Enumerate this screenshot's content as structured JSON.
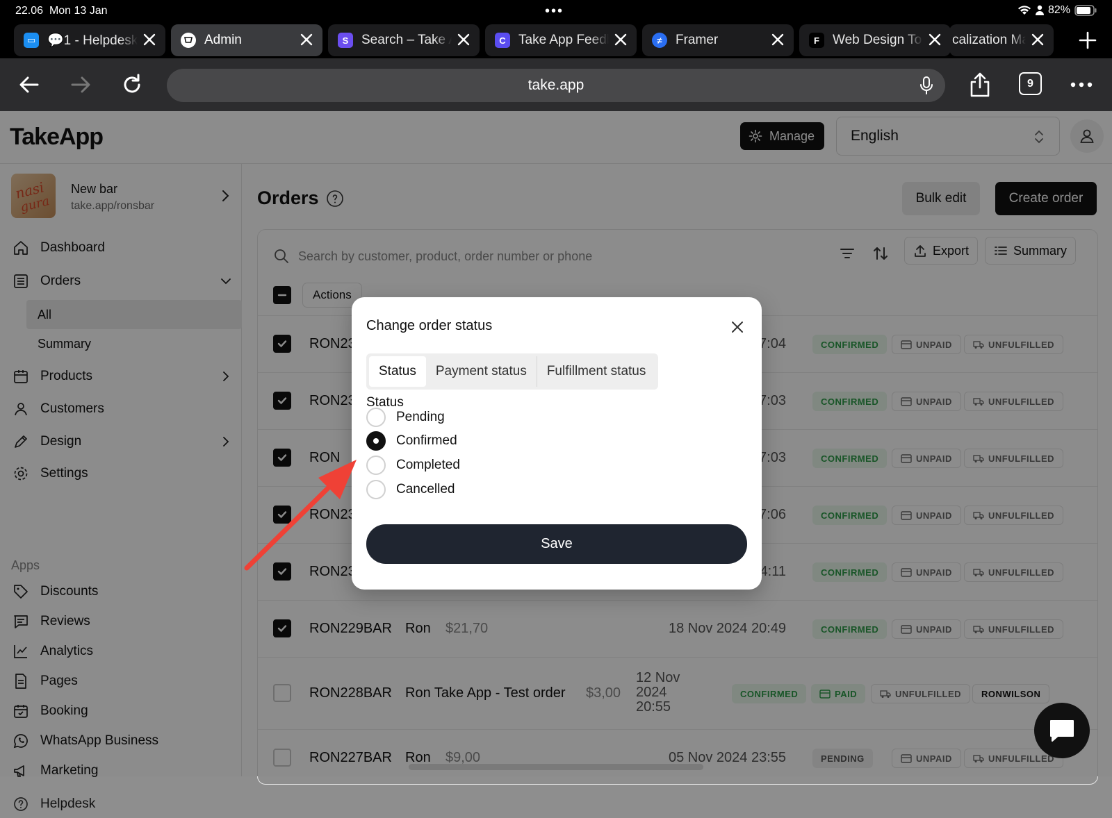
{
  "status_bar": {
    "time": "22.06",
    "date": "Mon 13 Jan",
    "battery": "82%"
  },
  "browser": {
    "tabs": [
      {
        "title": "💬1 - Helpdesk",
        "icon": "chat-icon"
      },
      {
        "title": "Admin",
        "icon": "takeapp-icon"
      },
      {
        "title": "Search – Take A",
        "icon": "s-icon"
      },
      {
        "title": "Take App Feedb",
        "icon": "c-icon"
      },
      {
        "title": "Framer",
        "icon": "framer-icon"
      },
      {
        "title": "Web Design To",
        "icon": "web-icon"
      },
      {
        "title": "calization Ma",
        "icon": "none"
      }
    ],
    "url": "take.app",
    "tab_count": "9"
  },
  "header": {
    "logo": "TakeApp",
    "manage_label": "Manage",
    "language": "English"
  },
  "sidebar": {
    "store_name": "New bar",
    "store_url": "take.app/ronsbar",
    "items": [
      {
        "label": "Dashboard"
      },
      {
        "label": "Orders"
      },
      {
        "label": "Products"
      },
      {
        "label": "Customers"
      },
      {
        "label": "Design"
      },
      {
        "label": "Settings"
      }
    ],
    "orders_sub": [
      "All",
      "Summary"
    ],
    "apps_label": "Apps",
    "apps": [
      "Discounts",
      "Reviews",
      "Analytics",
      "Pages",
      "Booking",
      "WhatsApp Business",
      "Marketing",
      "Helpdesk"
    ]
  },
  "main": {
    "title": "Orders",
    "bulk_edit": "Bulk edit",
    "create_order": "Create order",
    "search_placeholder": "Search by customer, product, order number or phone",
    "export": "Export",
    "summary": "Summary",
    "actions": "Actions"
  },
  "orders": [
    {
      "number": "RON23",
      "customer": "",
      "amount": "",
      "date": "17:04",
      "status": "CONFIRMED",
      "payment": "UNPAID",
      "fulfillment": "UNFULFILLED",
      "checked": true
    },
    {
      "number": "RON23",
      "customer": "",
      "amount": "",
      "date": "17:03",
      "status": "CONFIRMED",
      "payment": "UNPAID",
      "fulfillment": "UNFULFILLED",
      "checked": true
    },
    {
      "number": "RON",
      "customer": "",
      "amount": "",
      "date": "17:03",
      "status": "CONFIRMED",
      "payment": "UNPAID",
      "fulfillment": "UNFULFILLED",
      "checked": true
    },
    {
      "number": "RON23",
      "customer": "",
      "amount": "",
      "date": "17:06",
      "status": "CONFIRMED",
      "payment": "UNPAID",
      "fulfillment": "UNFULFILLED",
      "checked": true
    },
    {
      "number": "RON23",
      "customer": "",
      "amount": "",
      "date": "14:11",
      "status": "CONFIRMED",
      "payment": "UNPAID",
      "fulfillment": "UNFULFILLED",
      "checked": true
    },
    {
      "number": "RON229BAR",
      "customer": "Ron",
      "amount": "$21,70",
      "date": "18 Nov 2024 20:49",
      "status": "CONFIRMED",
      "payment": "UNPAID",
      "fulfillment": "UNFULFILLED",
      "checked": true
    },
    {
      "number": "RON228BAR",
      "customer": "Ron Take App - Test order",
      "amount": "$3,00",
      "date": "12 Nov 2024 20:55",
      "status": "CONFIRMED",
      "payment": "PAID",
      "fulfillment": "UNFULFILLED",
      "tag": "RONWILSON",
      "checked": false
    },
    {
      "number": "RON227BAR",
      "customer": "Ron",
      "amount": "$9,00",
      "date": "05 Nov 2024 23:55",
      "status": "PENDING",
      "payment": "UNPAID",
      "fulfillment": "UNFULFILLED",
      "checked": false
    }
  ],
  "modal": {
    "title": "Change order status",
    "tabs": [
      "Status",
      "Payment status",
      "Fulfillment status"
    ],
    "active_tab": "Status",
    "section_label": "Status",
    "options": [
      "Pending",
      "Confirmed",
      "Completed",
      "Cancelled"
    ],
    "selected": "Confirmed",
    "save_label": "Save"
  },
  "colors": {
    "accent": "#111111",
    "annotation_arrow": "#ef4136",
    "confirmed": "#2c9b47"
  }
}
